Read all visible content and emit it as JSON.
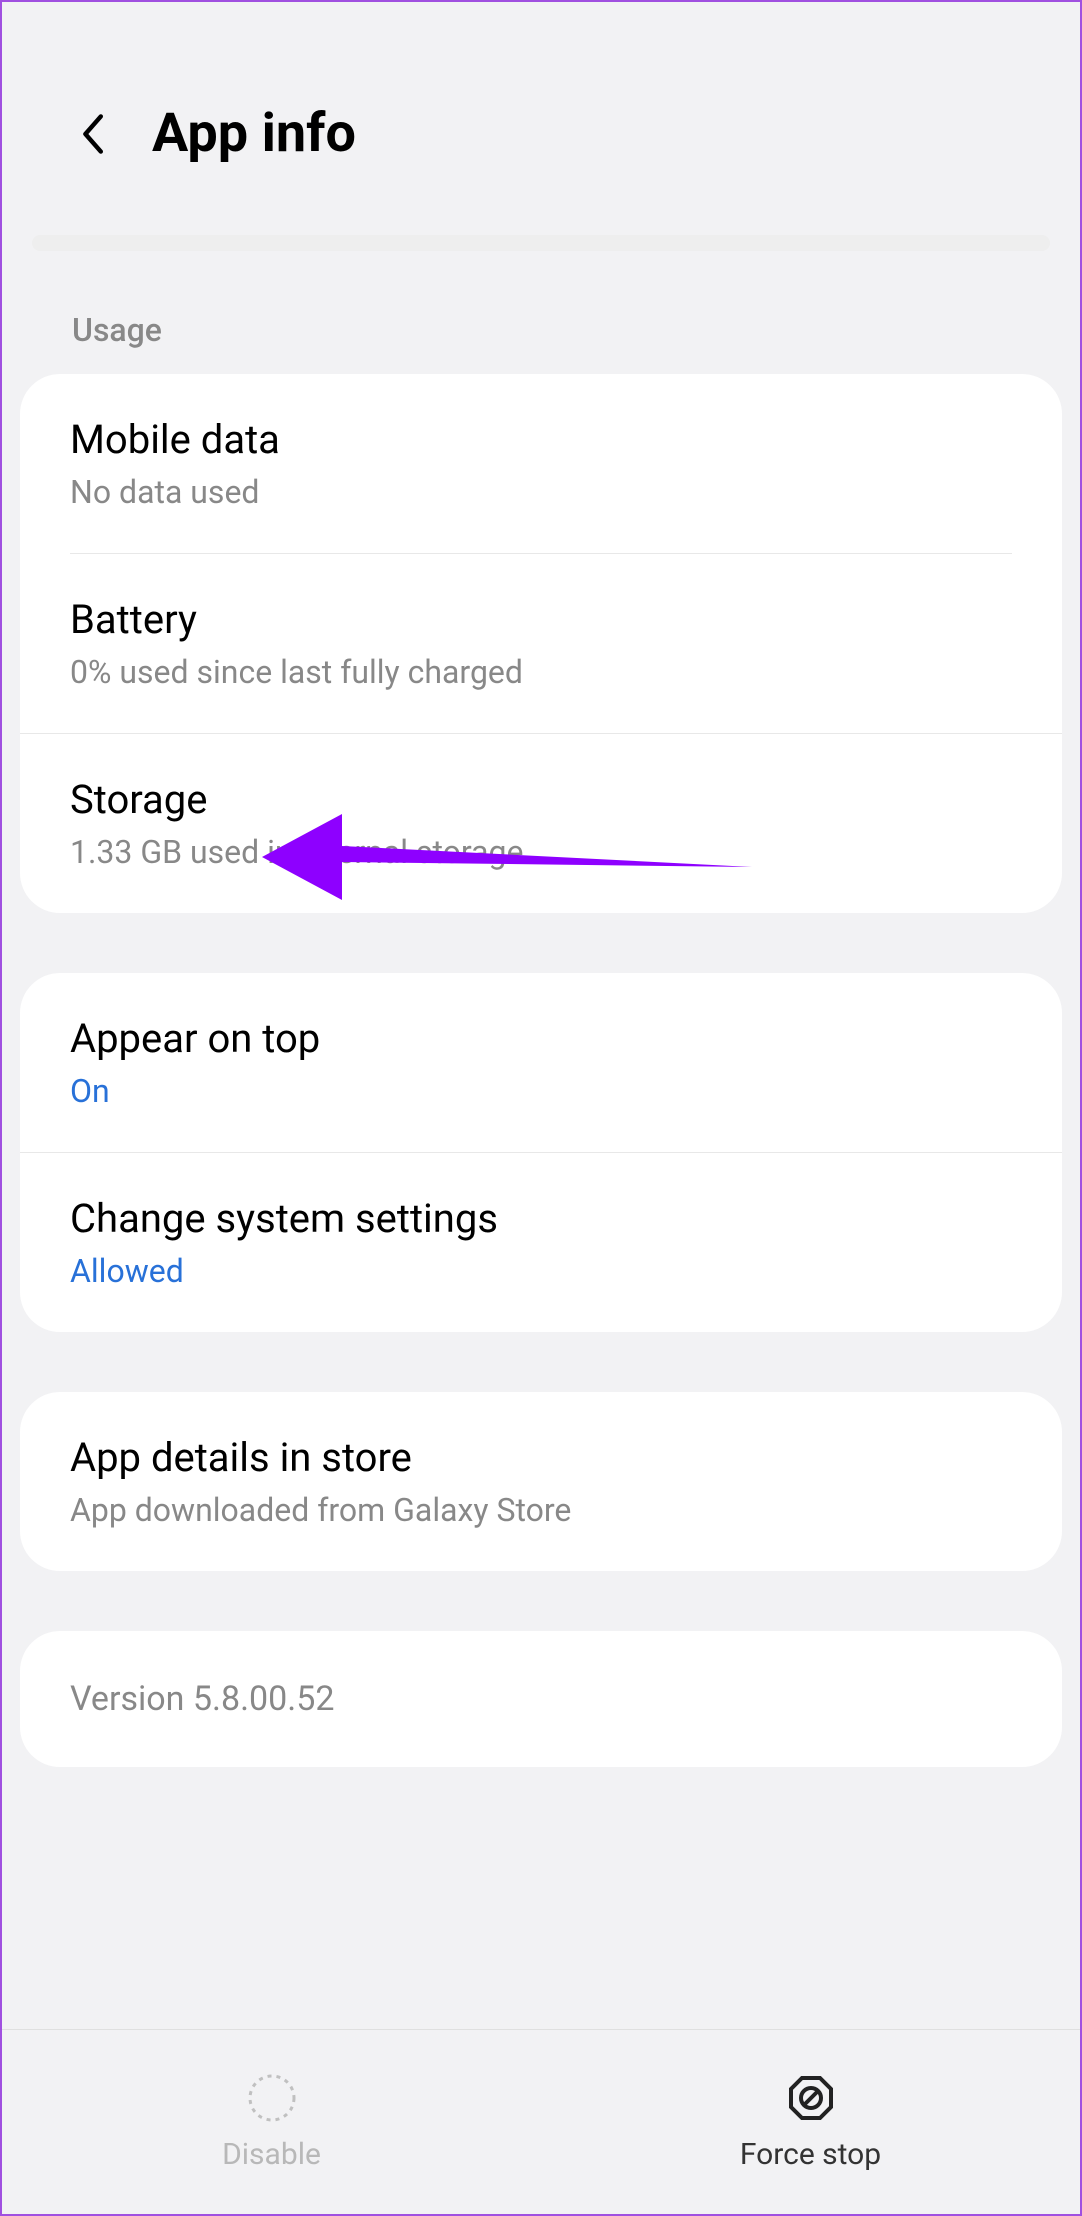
{
  "header": {
    "title": "App info"
  },
  "sections": {
    "usage_label": "Usage",
    "mobile_data": {
      "title": "Mobile data",
      "subtitle": "No data used"
    },
    "battery": {
      "title": "Battery",
      "subtitle": "0% used since last fully charged"
    },
    "storage": {
      "title": "Storage",
      "subtitle": "1.33 GB used in Internal storage"
    },
    "appear_on_top": {
      "title": "Appear on top",
      "subtitle": "On"
    },
    "change_system": {
      "title": "Change system settings",
      "subtitle": "Allowed"
    },
    "app_details": {
      "title": "App details in store",
      "subtitle": "App downloaded from Galaxy Store"
    },
    "version": "Version 5.8.00.52"
  },
  "bottom_bar": {
    "disable": "Disable",
    "force_stop": "Force stop"
  }
}
